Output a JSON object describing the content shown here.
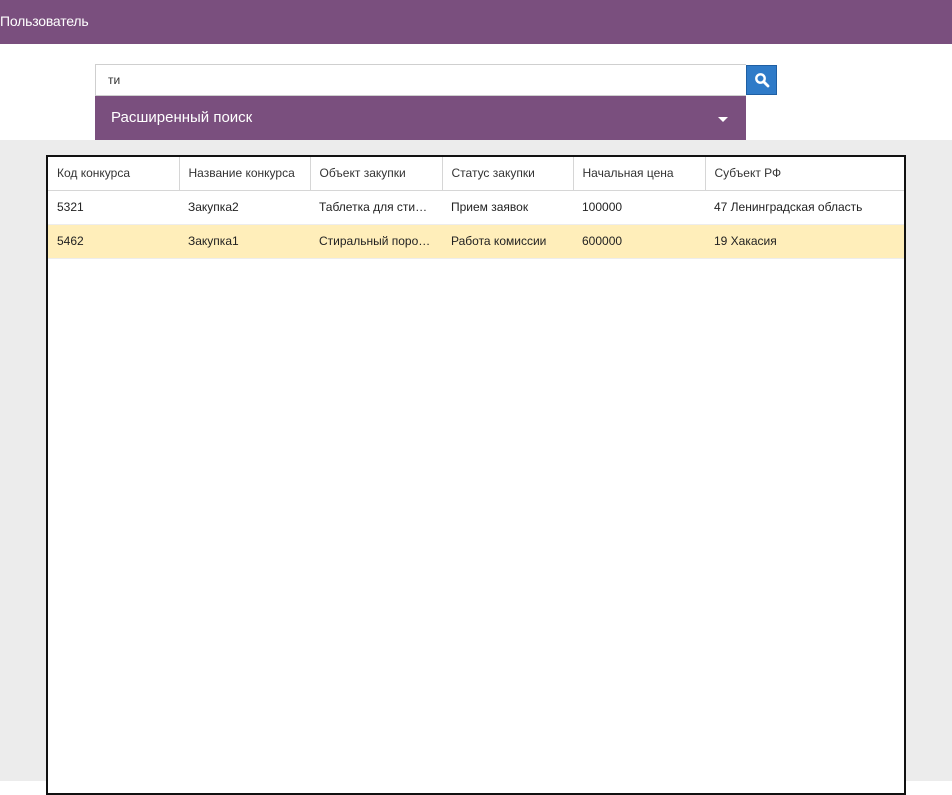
{
  "header": {
    "title": "Пользователь",
    "color": "#7a4f7e"
  },
  "search": {
    "value": "ти",
    "button_icon": "search-icon",
    "button_color": "#2f7bc8"
  },
  "advanced_search": {
    "label": "Расширенный поиск",
    "icon": "caret-down-icon"
  },
  "table": {
    "columns": [
      "Код конкурса",
      "Название конкурса",
      "Объект закупки",
      "Статус закупки",
      "Начальная цена",
      "Субъект РФ"
    ],
    "rows": [
      {
        "code": "5321",
        "name": "Закупка2",
        "object": "Таблетка для стирки",
        "status": "Прием заявок",
        "price": "100000",
        "region": "47 Ленинградская область"
      },
      {
        "code": "5462",
        "name": "Закупка1",
        "object": "Стиральный порошок",
        "status": "Работа комиссии",
        "price": "600000",
        "region": "19 Хакасия",
        "selected": true
      }
    ],
    "selected_row_color": "#ffeeba"
  }
}
